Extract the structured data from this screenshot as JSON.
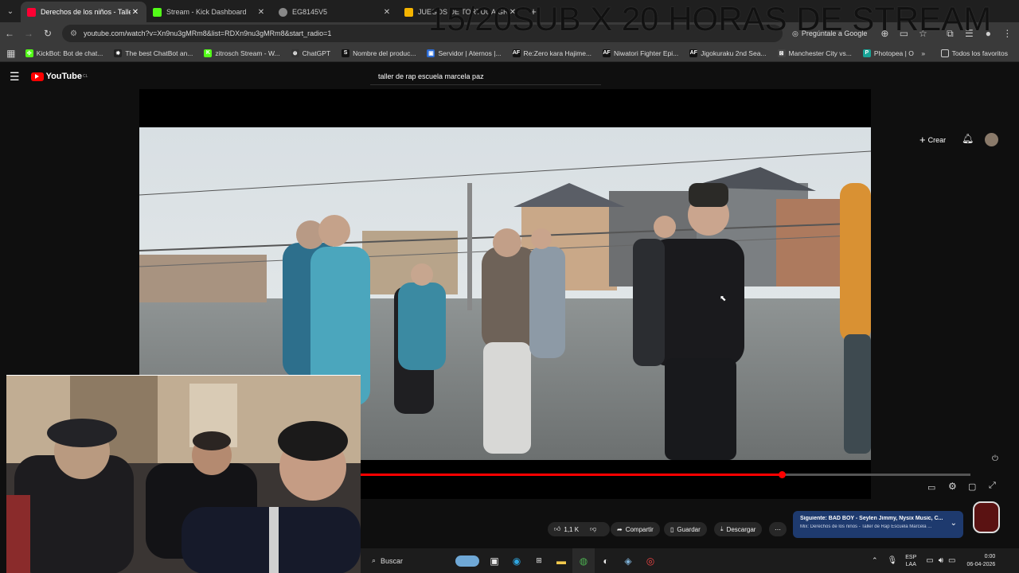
{
  "overlay": {
    "stream_title": "15/20SUB X  20 HORAS DE STREAM"
  },
  "tabs": [
    {
      "label": "Derechos de los niños - Taller d",
      "active": true,
      "favicon_color": "#ff0033"
    },
    {
      "label": "Stream - Kick Dashboard",
      "active": false,
      "favicon_color": "#53fc18"
    },
    {
      "label": "EG8145V5",
      "active": false,
      "favicon_color": "#888888"
    },
    {
      "label": "JUEGOS DE TORTUGA GRATIS",
      "active": false,
      "favicon_color": "#f5b400"
    }
  ],
  "address": {
    "url": "youtube.com/watch?v=Xn9nu3gMRm8&list=RDXn9nu3gMRm8&start_radio=1",
    "ask_label": "Pregúntale a Google"
  },
  "bookmarks": [
    {
      "label": "KickBot: Bot de chat...",
      "color": "#53fc18",
      "glyph": "✣"
    },
    {
      "label": "The best ChatBot an...",
      "color": "#222222",
      "glyph": "✸"
    },
    {
      "label": "zitrosch Stream - W...",
      "color": "#53fc18",
      "glyph": "K"
    },
    {
      "label": "ChatGPT",
      "color": "#333333",
      "glyph": "⊛"
    },
    {
      "label": "Nombre del produc...",
      "color": "#111111",
      "glyph": "S"
    },
    {
      "label": "Servidor | Aternos |...",
      "color": "#2a6bd6",
      "glyph": "▣"
    },
    {
      "label": "Re:Zero kara Hajime...",
      "color": "#111111",
      "glyph": "AF"
    },
    {
      "label": "Niwatori Fighter Epi...",
      "color": "#111111",
      "glyph": "AF"
    },
    {
      "label": "Jigokuraku 2nd Sea...",
      "color": "#111111",
      "glyph": "AF"
    },
    {
      "label": "Manchester City vs...",
      "color": "#444444",
      "glyph": "⊠"
    },
    {
      "label": "Photopea | Online P...",
      "color": "#18a497",
      "glyph": "P"
    }
  ],
  "bookmarks_all": "Todos los favoritos",
  "youtube": {
    "logo": "YouTube",
    "logo_region": "CL",
    "search_query": "taller de rap escuela marcela paz",
    "create_label": "Crear",
    "progress": 0.69,
    "likes": "1,1 K",
    "share_label": "Compartir",
    "save_label": "Guardar",
    "download_label": "Descargar",
    "next_title": "Siguiente: BAD BOY - Seylen Jimmy, Nysix Music, C...",
    "next_sub": "Mix: Derechos de los niños - Taller de Rap Escuela Marcela ..."
  },
  "taskbar": {
    "search_label": "Buscar",
    "lang": "ESP",
    "lang2": "LAA",
    "time": "0:00",
    "date": "06-04-2026"
  }
}
